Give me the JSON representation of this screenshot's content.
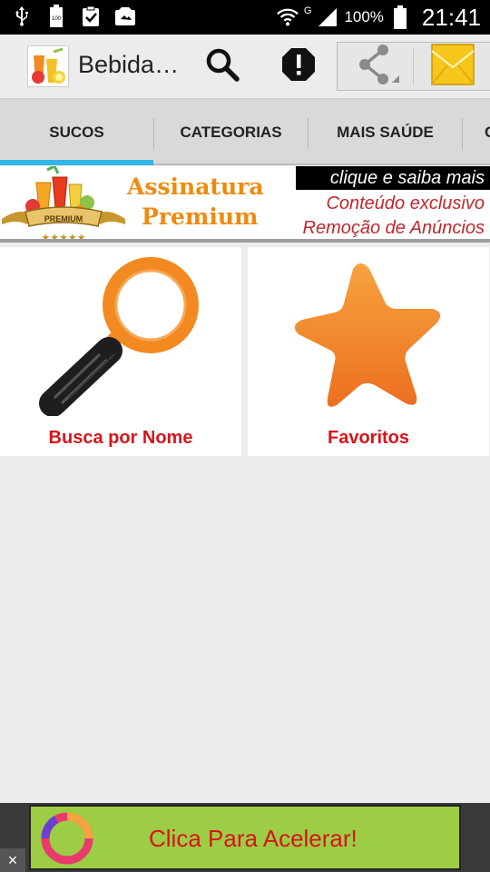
{
  "status_bar": {
    "icons_left": [
      "usb-icon",
      "battery-100-icon",
      "clipboard-check-icon",
      "photo-icon"
    ],
    "network": "G",
    "battery": "100%",
    "time": "21:41"
  },
  "action_bar": {
    "title": "Bebida…",
    "actions": [
      "search-icon",
      "alert-icon",
      "share-icon",
      "mail-icon"
    ]
  },
  "tabs": [
    {
      "label": "SUCOS",
      "selected": true
    },
    {
      "label": "CATEGORIAS",
      "selected": false
    },
    {
      "label": "MAIS SAÚDE",
      "selected": false
    },
    {
      "label": "C",
      "selected": false
    }
  ],
  "premium_banner": {
    "badge": "PREMIUM",
    "title_line1": "Assinatura",
    "title_line2": "Premium",
    "cta": "clique e saiba mais",
    "line1": "Conteúdo exclusivo",
    "line2": "Remoção de Anúncios"
  },
  "grid": [
    {
      "label": "Busca por Nome",
      "icon": "magnifier-icon"
    },
    {
      "label": "Favoritos",
      "icon": "star-icon"
    }
  ],
  "ad": {
    "text": "Clica Para Acelerar!",
    "close": "×"
  },
  "colors": {
    "accent": "#33b5e5",
    "label_red": "#d8141a",
    "premium_orange": "#ef8a0e",
    "ad_green": "#9ccd44"
  }
}
